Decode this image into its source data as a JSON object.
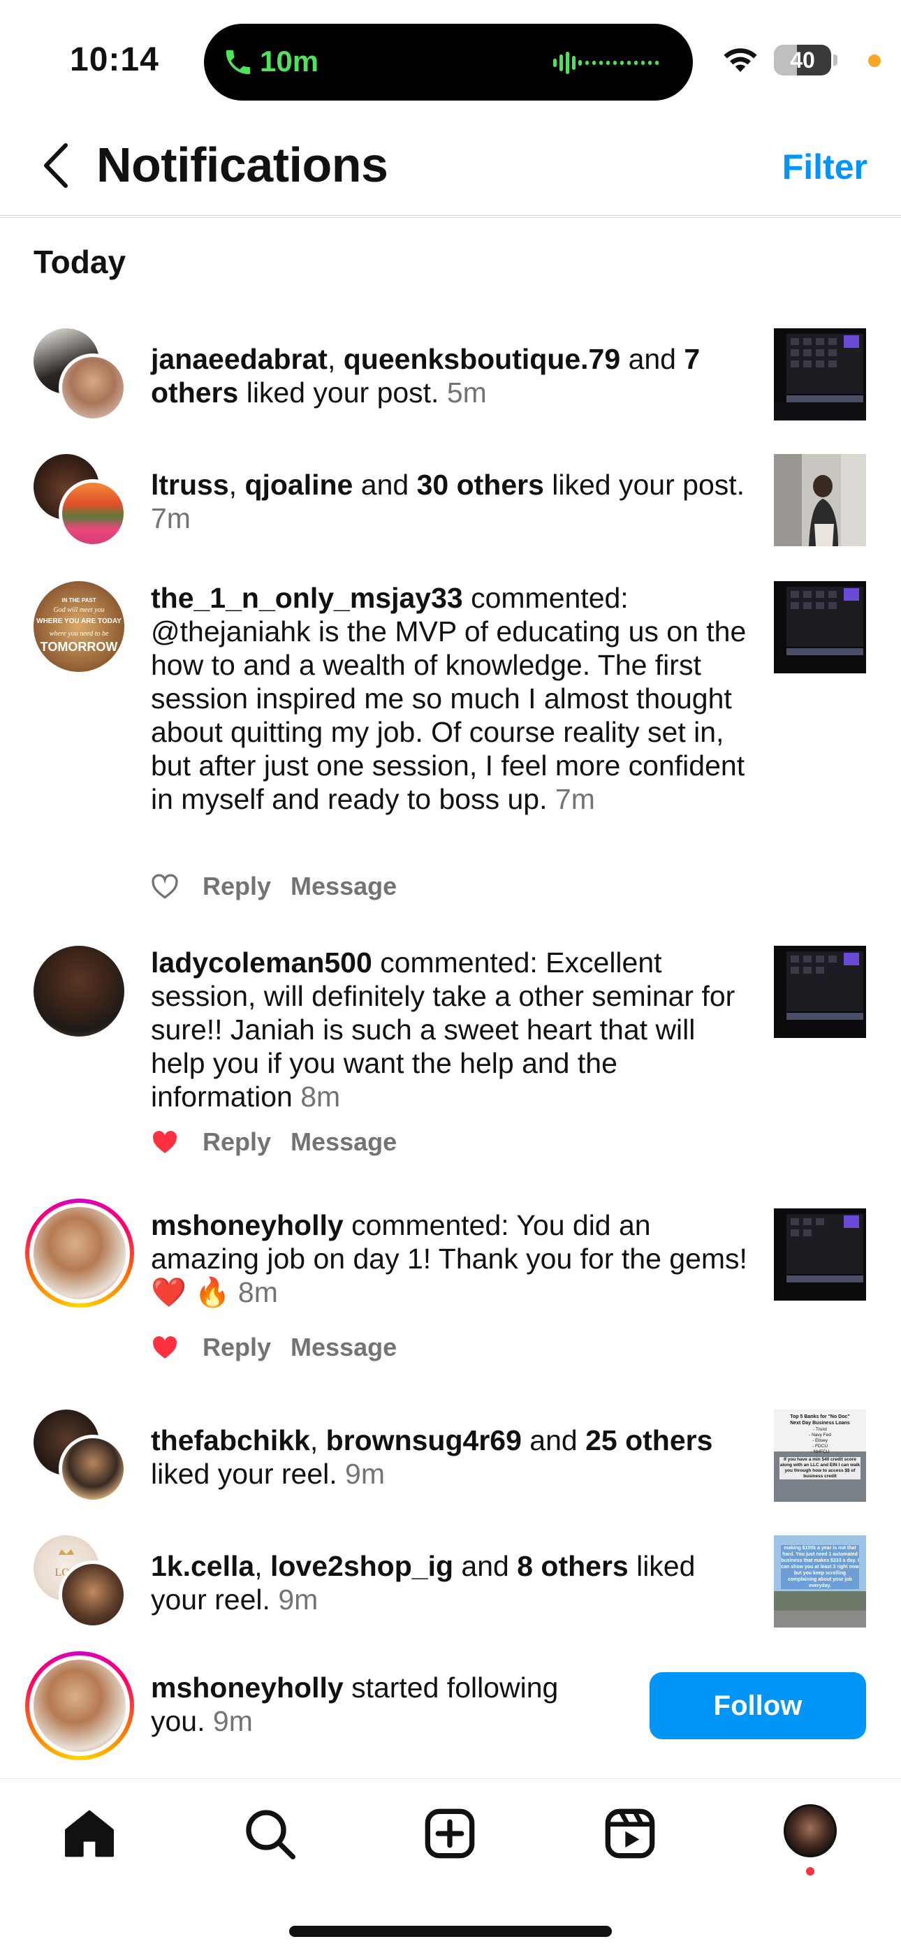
{
  "status_bar": {
    "time": "10:14",
    "call_duration": "10m",
    "battery_percent": "40",
    "battery_level": 0.4
  },
  "header": {
    "title": "Notifications",
    "filter_label": "Filter"
  },
  "section": {
    "title": "Today"
  },
  "notifications": [
    {
      "users": [
        "janaeedabrat",
        "queenksboutique.79"
      ],
      "others": "7 others",
      "connector": " and ",
      "text": " liked your post.",
      "time": "5m",
      "thumb": "screen-photo"
    },
    {
      "users": [
        "ltruss",
        "qjoaline"
      ],
      "others": "30 others",
      "connector": " and ",
      "text": " liked your post.",
      "time": "7m",
      "thumb": "selfie-photo"
    },
    {
      "user": "the_1_n_only_msjay33",
      "text": " commented: @thejaniahk is the MVP of educating us on the how to and a wealth of knowledge. The first session inspired me so much I almost thought about quitting my job. Of course reality set in, but after just one session, I feel more confident in myself and ready to boss up.",
      "time": "7m",
      "reply_label": "Reply",
      "message_label": "Message",
      "liked": false,
      "avatar_lines": [
        "IN THE PAST",
        "God will meet you",
        "WHERE YOU ARE TODAY",
        "where you need to be",
        "TOMORROW"
      ]
    },
    {
      "user": "ladycoleman500",
      "text": " commented: Excellent session, will definitely take a other seminar for sure!! Janiah is such a sweet heart that will help you if you want the help and the information",
      "time": "8m",
      "reply_label": "Reply",
      "message_label": "Message",
      "liked": true
    },
    {
      "user": "mshoneyholly",
      "text": " commented: You did an amazing job on day 1! Thank you for the gems! ❤️ 🔥",
      "time": "8m",
      "reply_label": "Reply",
      "message_label": "Message",
      "liked": true
    },
    {
      "users": [
        "thefabchikk",
        "brownsug4r69"
      ],
      "others": "25 others",
      "connector": " and ",
      "text": " liked your reel.",
      "time": "9m",
      "thumb_lines": [
        "Top 5 Banks for \"No Doc\"",
        "Next Day Business Loans",
        "- Truist",
        "- Navy Fed",
        "- Ebsey",
        "- FDCU",
        "- NHFCU",
        "If you have a min 540 credit score along with an LLC and EIN I can walk you through how to access $$ of business credit"
      ]
    },
    {
      "users": [
        "1k.cella",
        "love2shop_ig"
      ],
      "others": "8 others",
      "connector": " and ",
      "text": " liked your reel.",
      "time": "9m",
      "thumb_lines": [
        "making $100k a year is not that hard. You just need 1 automated business that makes $333 a day. I can show you at least 3 right now but you keep scrolling complaining about your job everyday."
      ]
    },
    {
      "user": "mshoneyholly",
      "text": " started following you.",
      "time": "9m",
      "follow_label": "Follow"
    }
  ],
  "tab_bar": {
    "items": [
      "home-icon",
      "search-icon",
      "create-icon",
      "reels-icon",
      "profile-avatar"
    ]
  },
  "colors": {
    "accent": "#0095f6",
    "like": "#ff3040",
    "secondary_text": "#737373",
    "call_green": "#4ee35b"
  }
}
